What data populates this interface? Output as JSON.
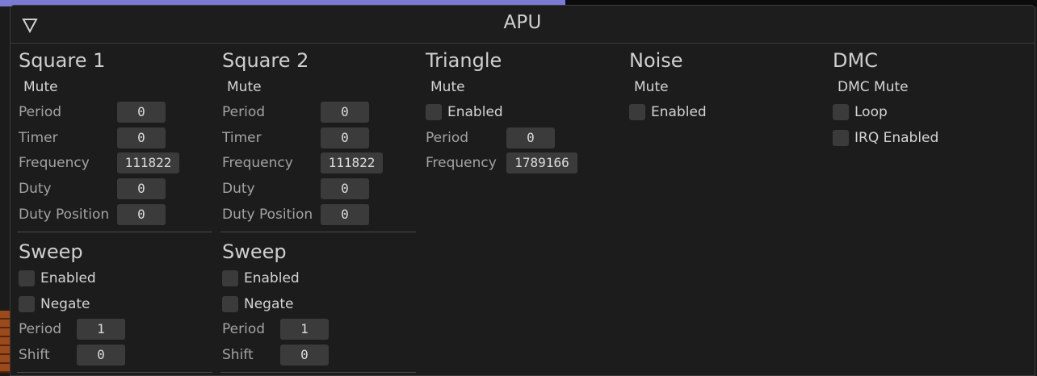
{
  "window": {
    "title": "APU"
  },
  "square1": {
    "title": "Square 1",
    "mute": "Mute",
    "rows": [
      {
        "label": "Period",
        "value": "0"
      },
      {
        "label": "Timer",
        "value": "0"
      },
      {
        "label": "Frequency",
        "value": "111822"
      },
      {
        "label": "Duty",
        "value": "0"
      },
      {
        "label": "Duty Position",
        "value": "0"
      }
    ],
    "sweep": {
      "title": "Sweep",
      "enabled_label": "Enabled",
      "negate_label": "Negate",
      "period_label": "Period",
      "period_value": "1",
      "shift_label": "Shift",
      "shift_value": "0"
    }
  },
  "square2": {
    "title": "Square 2",
    "mute": "Mute",
    "rows": [
      {
        "label": "Period",
        "value": "0"
      },
      {
        "label": "Timer",
        "value": "0"
      },
      {
        "label": "Frequency",
        "value": "111822"
      },
      {
        "label": "Duty",
        "value": "0"
      },
      {
        "label": "Duty Position",
        "value": "0"
      }
    ],
    "sweep": {
      "title": "Sweep",
      "enabled_label": "Enabled",
      "negate_label": "Negate",
      "period_label": "Period",
      "period_value": "1",
      "shift_label": "Shift",
      "shift_value": "0"
    }
  },
  "triangle": {
    "title": "Triangle",
    "mute": "Mute",
    "enabled_label": "Enabled",
    "period_label": "Period",
    "period_value": "0",
    "frequency_label": "Frequency",
    "frequency_value": "1789166"
  },
  "noise": {
    "title": "Noise",
    "mute": "Mute",
    "enabled_label": "Enabled"
  },
  "dmc": {
    "title": "DMC",
    "mute": "DMC Mute",
    "loop_label": "Loop",
    "irq_label": "IRQ Enabled"
  },
  "colors": {
    "panel": "#1c1c1c",
    "widget": "#3b3b3b",
    "text": "#d4d4d4",
    "label": "#a3a3a3"
  }
}
